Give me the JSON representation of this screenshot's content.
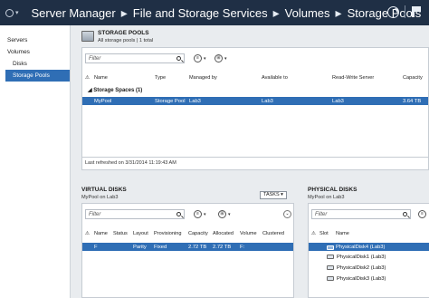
{
  "titlebar": {
    "crumbs": [
      "Server Manager",
      "File and Storage Services",
      "Volumes",
      "Storage Pools"
    ]
  },
  "sidebar": {
    "items": [
      {
        "label": "Servers"
      },
      {
        "label": "Volumes"
      },
      {
        "label": "Disks"
      },
      {
        "label": "Storage Pools"
      }
    ]
  },
  "storage_pools": {
    "title": "STORAGE POOLS",
    "subtitle": "All storage pools | 1 total",
    "filter_placeholder": "Filter",
    "columns": [
      "Name",
      "Type",
      "Managed by",
      "Available to",
      "Read-Write Server",
      "Capacity"
    ],
    "group_label": "Storage Spaces (1)",
    "rows": [
      {
        "name": "MyPool",
        "type": "Storage Pool",
        "managed_by": "Lab3",
        "available_to": "Lab3",
        "rw_server": "Lab3",
        "capacity": "3.64 TB"
      }
    ],
    "last_refreshed": "Last refreshed on 3/31/2014 11:19:43 AM"
  },
  "virtual_disks": {
    "title": "VIRTUAL DISKS",
    "subtitle": "MyPool on Lab3",
    "tasks_label": "TASKS",
    "filter_placeholder": "Filter",
    "columns": [
      "Name",
      "Status",
      "Layout",
      "Provisioning",
      "Capacity",
      "Allocated",
      "Volume",
      "Clustered"
    ],
    "rows": [
      {
        "name": "F",
        "status": "",
        "layout": "Parity",
        "provisioning": "Fixed",
        "capacity": "2.72 TB",
        "allocated": "2.72 TB",
        "volume": "F:",
        "clustered": ""
      }
    ]
  },
  "physical_disks": {
    "title": "PHYSICAL DISKS",
    "subtitle": "MyPool on Lab3",
    "filter_placeholder": "Filter",
    "columns": [
      "Slot",
      "Name"
    ],
    "rows": [
      {
        "name": "PhysicalDisk4 (Lab3)"
      },
      {
        "name": "PhysicalDisk1 (Lab3)"
      },
      {
        "name": "PhysicalDisk2 (Lab3)"
      },
      {
        "name": "PhysicalDisk3 (Lab3)"
      }
    ]
  },
  "colors": {
    "titlebar": "#1f2f45",
    "selection": "#2f6eb5"
  }
}
